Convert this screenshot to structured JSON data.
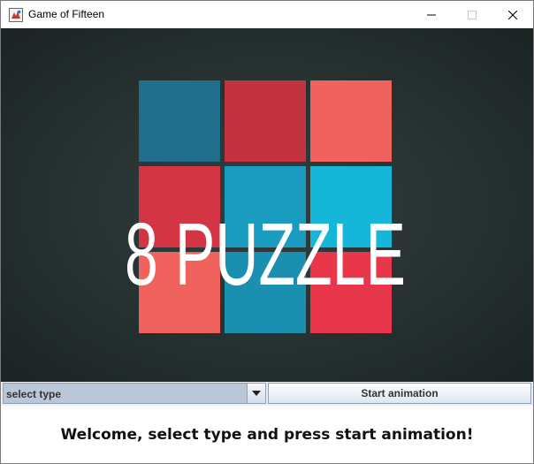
{
  "window": {
    "title": "Game of Fifteen"
  },
  "banner": {
    "heading": "8 PUZZLE",
    "tile_colors": [
      "#1f6f8b",
      "#c23240",
      "#f0625e",
      "#d43545",
      "#1a9bc0",
      "#16b6d9",
      "#f0625e",
      "#1a8fb0",
      "#e8374a"
    ]
  },
  "controls": {
    "type_select": {
      "value": "select type"
    },
    "start_button": {
      "label": "Start animation"
    }
  },
  "status": {
    "message": "Welcome, select type and press start animation!"
  }
}
